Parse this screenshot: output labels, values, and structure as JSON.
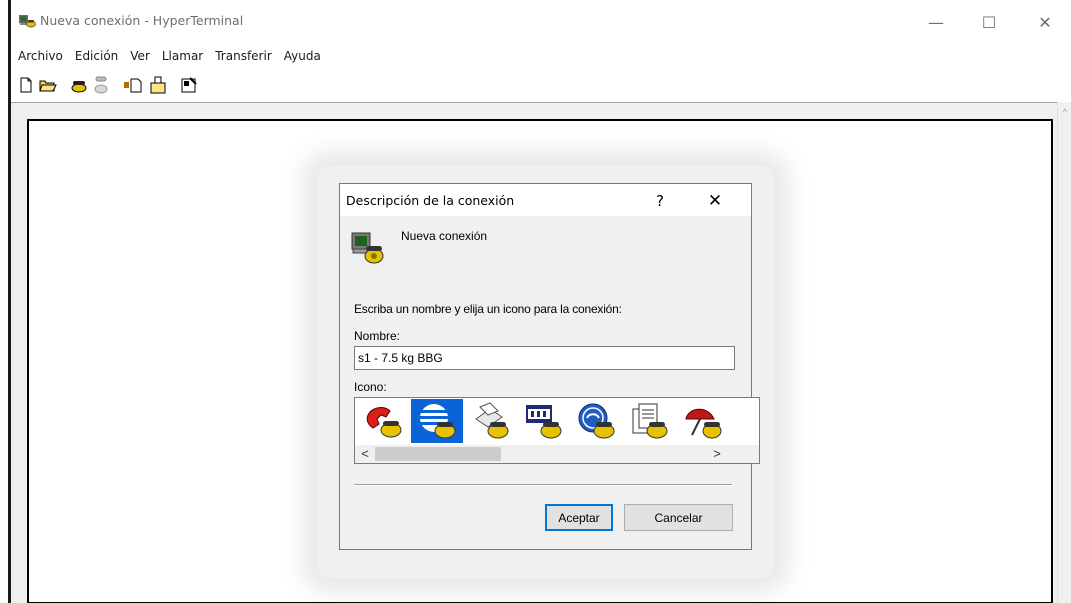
{
  "window": {
    "title": "Nueva conexión - HyperTerminal",
    "minimize_glyph": "—",
    "maximize_glyph": "☐",
    "close_glyph": "✕",
    "app_icon": "hyperterminal-icon"
  },
  "menu": [
    "Archivo",
    "Edición",
    "Ver",
    "Llamar",
    "Transferir",
    "Ayuda"
  ],
  "toolbar": {
    "icons": [
      "new-file-icon",
      "open-folder-icon",
      "dial-phone-icon",
      "disconnect-phone-icon",
      "send-file-icon",
      "receive-file-icon",
      "properties-icon"
    ]
  },
  "scrollbar": {
    "up_glyph": "^"
  },
  "dialog": {
    "title": "Descripción de la conexión",
    "help_glyph": "?",
    "close_glyph": "✕",
    "heading": "Nueva conexión",
    "prompt": "Escriba un nombre y elija un icono para la conexión:",
    "name_label": "Nombre:",
    "name_value": "s1 - 7.5 kg BBG",
    "icon_label": "Icono:",
    "icon_list": [
      "red-phone-icon",
      "globe-stripes-icon",
      "fax-icon",
      "mci-icon",
      "ge-icon",
      "documents-icon",
      "umbrella-icon"
    ],
    "selected_icon_index": 1,
    "scroll_left_glyph": "<",
    "scroll_right_glyph": ">",
    "ok_label": "Aceptar",
    "cancel_label": "Cancelar"
  },
  "colors": {
    "selection": "#0a64d8",
    "default_button_border": "#0078d7",
    "dialog_bg": "#f0f0f0"
  }
}
